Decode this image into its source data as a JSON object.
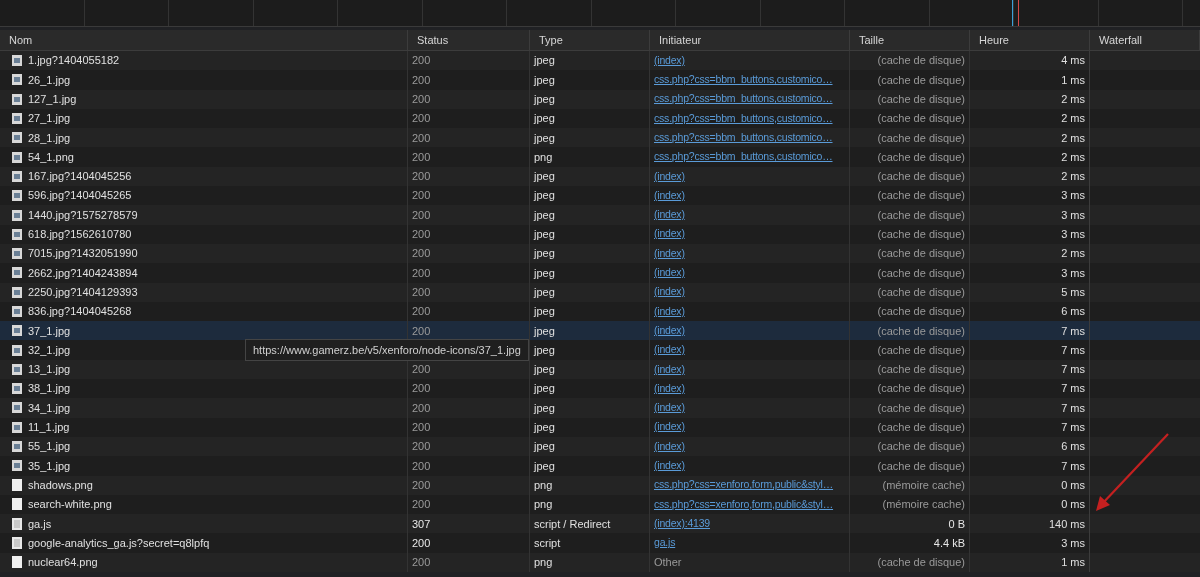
{
  "columns": [
    "Nom",
    "Status",
    "Type",
    "Initiateur",
    "Taille",
    "Heure",
    "Waterfall"
  ],
  "rows": [
    {
      "name": "1.jpg?1404055182",
      "kind": "image",
      "status": "200",
      "type": "jpeg",
      "initiator": "(index)",
      "initiator_link": true,
      "size": "(cache de disque)",
      "time": "4 ms",
      "cached": true,
      "selected": false
    },
    {
      "name": "26_1.jpg",
      "kind": "image",
      "status": "200",
      "type": "jpeg",
      "initiator": "css.php?css=bbm_buttons,customico…",
      "initiator_link": true,
      "size": "(cache de disque)",
      "time": "1 ms",
      "cached": true,
      "selected": false
    },
    {
      "name": "127_1.jpg",
      "kind": "image",
      "status": "200",
      "type": "jpeg",
      "initiator": "css.php?css=bbm_buttons,customico…",
      "initiator_link": true,
      "size": "(cache de disque)",
      "time": "2 ms",
      "cached": true,
      "selected": false
    },
    {
      "name": "27_1.jpg",
      "kind": "image",
      "status": "200",
      "type": "jpeg",
      "initiator": "css.php?css=bbm_buttons,customico…",
      "initiator_link": true,
      "size": "(cache de disque)",
      "time": "2 ms",
      "cached": true,
      "selected": false
    },
    {
      "name": "28_1.jpg",
      "kind": "image",
      "status": "200",
      "type": "jpeg",
      "initiator": "css.php?css=bbm_buttons,customico…",
      "initiator_link": true,
      "size": "(cache de disque)",
      "time": "2 ms",
      "cached": true,
      "selected": false
    },
    {
      "name": "54_1.png",
      "kind": "image",
      "status": "200",
      "type": "png",
      "initiator": "css.php?css=bbm_buttons,customico…",
      "initiator_link": true,
      "size": "(cache de disque)",
      "time": "2 ms",
      "cached": true,
      "selected": false
    },
    {
      "name": "167.jpg?1404045256",
      "kind": "image",
      "status": "200",
      "type": "jpeg",
      "initiator": "(index)",
      "initiator_link": true,
      "size": "(cache de disque)",
      "time": "2 ms",
      "cached": true,
      "selected": false
    },
    {
      "name": "596.jpg?1404045265",
      "kind": "image",
      "status": "200",
      "type": "jpeg",
      "initiator": "(index)",
      "initiator_link": true,
      "size": "(cache de disque)",
      "time": "3 ms",
      "cached": true,
      "selected": false
    },
    {
      "name": "1440.jpg?1575278579",
      "kind": "image",
      "status": "200",
      "type": "jpeg",
      "initiator": "(index)",
      "initiator_link": true,
      "size": "(cache de disque)",
      "time": "3 ms",
      "cached": true,
      "selected": false
    },
    {
      "name": "618.jpg?1562610780",
      "kind": "image",
      "status": "200",
      "type": "jpeg",
      "initiator": "(index)",
      "initiator_link": true,
      "size": "(cache de disque)",
      "time": "3 ms",
      "cached": true,
      "selected": false
    },
    {
      "name": "7015.jpg?1432051990",
      "kind": "image",
      "status": "200",
      "type": "jpeg",
      "initiator": "(index)",
      "initiator_link": true,
      "size": "(cache de disque)",
      "time": "2 ms",
      "cached": true,
      "selected": false
    },
    {
      "name": "2662.jpg?1404243894",
      "kind": "image",
      "status": "200",
      "type": "jpeg",
      "initiator": "(index)",
      "initiator_link": true,
      "size": "(cache de disque)",
      "time": "3 ms",
      "cached": true,
      "selected": false
    },
    {
      "name": "2250.jpg?1404129393",
      "kind": "image",
      "status": "200",
      "type": "jpeg",
      "initiator": "(index)",
      "initiator_link": true,
      "size": "(cache de disque)",
      "time": "5 ms",
      "cached": true,
      "selected": false
    },
    {
      "name": "836.jpg?1404045268",
      "kind": "image",
      "status": "200",
      "type": "jpeg",
      "initiator": "(index)",
      "initiator_link": true,
      "size": "(cache de disque)",
      "time": "6 ms",
      "cached": true,
      "selected": false
    },
    {
      "name": "37_1.jpg",
      "kind": "image",
      "status": "200",
      "type": "jpeg",
      "initiator": "(index)",
      "initiator_link": true,
      "size": "(cache de disque)",
      "time": "7 ms",
      "cached": true,
      "selected": true
    },
    {
      "name": "32_1.jpg",
      "kind": "image",
      "type": "jpeg",
      "initiator": "(index)",
      "initiator_link": true,
      "size": "(cache de disque)",
      "time": "7 ms",
      "cached": true,
      "selected": false
    },
    {
      "name": "13_1.jpg",
      "kind": "image",
      "status": "200",
      "type": "jpeg",
      "initiator": "(index)",
      "initiator_link": true,
      "size": "(cache de disque)",
      "time": "7 ms",
      "cached": true,
      "selected": false
    },
    {
      "name": "38_1.jpg",
      "kind": "image",
      "status": "200",
      "type": "jpeg",
      "initiator": "(index)",
      "initiator_link": true,
      "size": "(cache de disque)",
      "time": "7 ms",
      "cached": true,
      "selected": false
    },
    {
      "name": "34_1.jpg",
      "kind": "image",
      "status": "200",
      "type": "jpeg",
      "initiator": "(index)",
      "initiator_link": true,
      "size": "(cache de disque)",
      "time": "7 ms",
      "cached": true,
      "selected": false
    },
    {
      "name": "11_1.jpg",
      "kind": "image",
      "status": "200",
      "type": "jpeg",
      "initiator": "(index)",
      "initiator_link": true,
      "size": "(cache de disque)",
      "time": "7 ms",
      "cached": true,
      "selected": false
    },
    {
      "name": "55_1.jpg",
      "kind": "image",
      "status": "200",
      "type": "jpeg",
      "initiator": "(index)",
      "initiator_link": true,
      "size": "(cache de disque)",
      "time": "6 ms",
      "cached": true,
      "selected": false
    },
    {
      "name": "35_1.jpg",
      "kind": "image",
      "status": "200",
      "type": "jpeg",
      "initiator": "(index)",
      "initiator_link": true,
      "size": "(cache de disque)",
      "time": "7 ms",
      "cached": true,
      "selected": false
    },
    {
      "name": "shadows.png",
      "kind": "file",
      "status": "200",
      "type": "png",
      "initiator": "css.php?css=xenforo,form,public&styl…",
      "initiator_link": true,
      "size": "(mémoire cache)",
      "time": "0 ms",
      "cached": true,
      "selected": false
    },
    {
      "name": "search-white.png",
      "kind": "file",
      "status": "200",
      "type": "png",
      "initiator": "css.php?css=xenforo,form,public&styl…",
      "initiator_link": true,
      "size": "(mémoire cache)",
      "time": "0 ms",
      "cached": true,
      "selected": false
    },
    {
      "name": "ga.js",
      "kind": "document",
      "status": "307",
      "type": "script / Redirect",
      "initiator": "(index):4139",
      "initiator_link": true,
      "size": "0 B",
      "time": "140 ms",
      "cached": false,
      "selected": false
    },
    {
      "name": "google-analytics_ga.js?secret=q8lpfq",
      "kind": "document",
      "status": "200",
      "type": "script",
      "initiator": "ga.js",
      "initiator_link": true,
      "size": "4.4 kB",
      "time": "3 ms",
      "cached": false,
      "selected": false
    },
    {
      "name": "nuclear64.png",
      "kind": "file",
      "status": "200",
      "type": "png",
      "initiator": "Other",
      "initiator_link": false,
      "size": "(cache de disque)",
      "time": "1 ms",
      "cached": true,
      "selected": false
    }
  ],
  "tooltip": "https://www.gamerz.be/v5/xenforo/node-icons/37_1.jpg"
}
